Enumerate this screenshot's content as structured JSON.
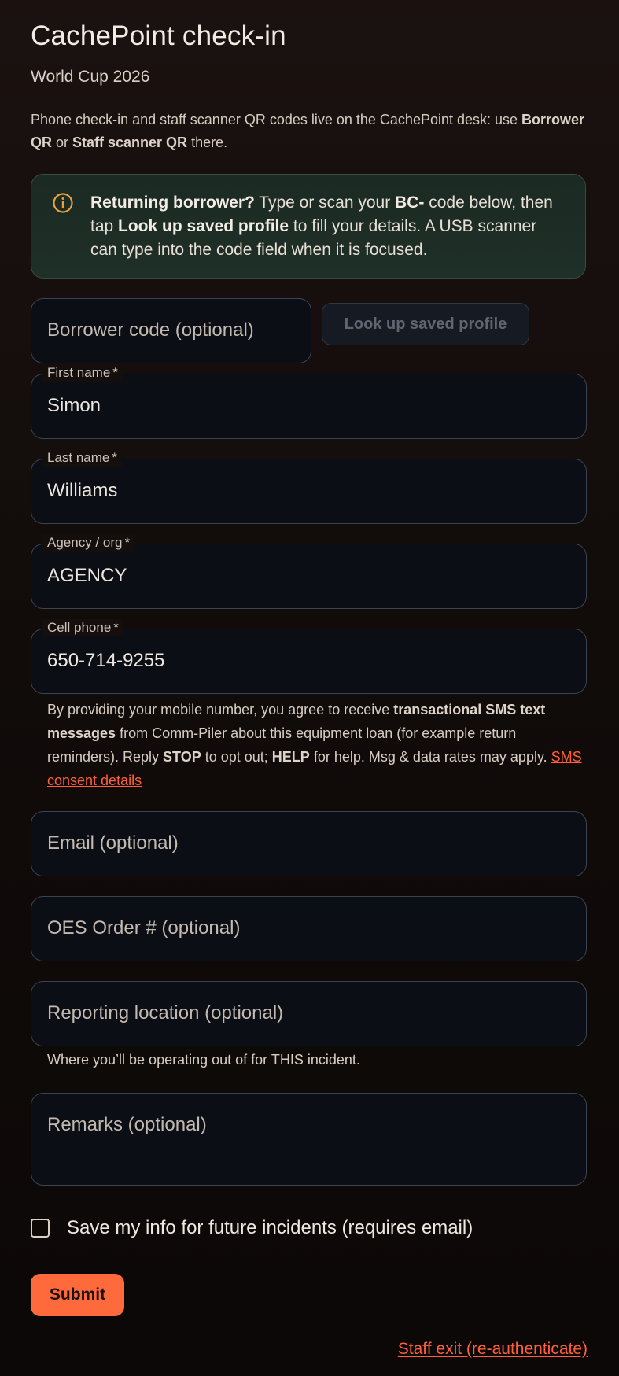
{
  "header": {
    "title": "CachePoint check-in",
    "subtitle": "World Cup 2026"
  },
  "intro": {
    "part1": "Phone check-in and staff scanner QR codes live on the CachePoint desk: use ",
    "borrower_qr": "Borrower QR",
    "part2": " or ",
    "staff_qr": "Staff scanner QR",
    "part3": " there."
  },
  "notice": {
    "icon": "info-icon",
    "bold1": "Returning borrower?",
    "text1": " Type or scan your ",
    "bold2": "BC-",
    "text2": " code below, then tap ",
    "bold3": "Look up saved profile",
    "text3": " to fill your details. A USB scanner can type into the code field when it is focused."
  },
  "borrower_code": {
    "placeholder": "Borrower code (optional)",
    "value": ""
  },
  "lookup_button": {
    "label": "Look up saved profile",
    "disabled": true
  },
  "fields": {
    "first_name": {
      "label": "First name",
      "required_mark": "*",
      "value": "Simon"
    },
    "last_name": {
      "label": "Last name",
      "required_mark": "*",
      "value": "Williams"
    },
    "agency": {
      "label": "Agency / org",
      "required_mark": "*",
      "value": "AGENCY"
    },
    "cell_phone": {
      "label": "Cell phone",
      "required_mark": "*",
      "value": "650-714-9255"
    },
    "email": {
      "placeholder": "Email (optional)",
      "value": ""
    },
    "oes_order": {
      "placeholder": "OES Order # (optional)",
      "value": ""
    },
    "reporting_location": {
      "placeholder": "Reporting location (optional)",
      "value": "",
      "helper": "Where you’ll be operating out of for THIS incident."
    },
    "remarks": {
      "placeholder": "Remarks (optional)",
      "value": ""
    }
  },
  "consent": {
    "t1": "By providing your mobile number, you agree to receive ",
    "b1": "transactional SMS text messages",
    "t2": " from Comm-Piler about this equipment loan (for example return reminders). Reply ",
    "b2": "STOP",
    "t3": " to opt out; ",
    "b3": "HELP",
    "t4": " for help. Msg & data rates may apply. ",
    "link": "SMS consent details"
  },
  "save_info": {
    "label": "Save my info for future incidents (requires email)",
    "checked": false
  },
  "submit": {
    "label": "Submit"
  },
  "staff_exit": {
    "label": "Staff exit (re-authenticate)"
  },
  "colors": {
    "accent": "#ff6a3d",
    "link": "#ff5f3a",
    "notice_bg": "#1f3028",
    "notice_icon": "#e8a23a",
    "field_bg": "#0b0e14",
    "field_border": "#3b4350"
  }
}
